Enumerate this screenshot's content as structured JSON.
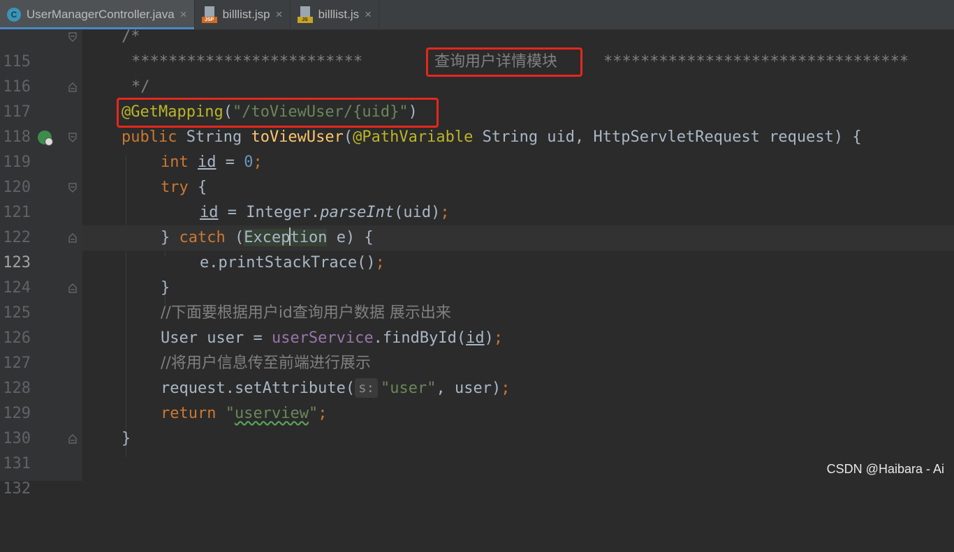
{
  "tabs": [
    {
      "label": "UserManagerController.java",
      "icon": "java-class-icon",
      "active": true
    },
    {
      "label": "billlist.jsp",
      "icon": "jsp-file-icon",
      "active": false
    },
    {
      "label": "billlist.js",
      "icon": "js-file-icon",
      "active": false
    }
  ],
  "tab_close_glyph": "×",
  "file_icon_badges": {
    "jsp": "JSP",
    "js": "JS"
  },
  "class_icon_letter": "C",
  "line_numbers": [
    "115",
    "116",
    "117",
    "118",
    "119",
    "120",
    "121",
    "122",
    "123",
    "124",
    "125",
    "126",
    "127",
    "128",
    "129",
    "130",
    "131",
    "132"
  ],
  "current_line": "123",
  "code": {
    "l115": "/*",
    "l116_stars_left": "*************************",
    "l116_title": "查询用户详情模块",
    "l116_stars_right": "*********************************",
    "l117": "*/",
    "l118_ann": "@GetMapping",
    "l118_open": "(",
    "l118_str": "\"/toViewUser/{uid}\"",
    "l118_close": ")",
    "l119_public": "public",
    "l119_string": " String ",
    "l119_method": "toViewUser",
    "l119_open": "(",
    "l119_ann": "@PathVariable",
    "l119_params": " String uid, HttpServletRequest request) {",
    "l120_int": "int",
    "l120_id": "id",
    "l120_eq": " = ",
    "l120_zero": "0",
    "l120_semi": ";",
    "l121_try": "try",
    "l121_brace": " {",
    "l122_id": "id",
    "l122_rest1": " = Integer.",
    "l122_parse": "parseInt",
    "l122_rest2": "(uid)",
    "l122_semi": ";",
    "l123_brace": "} ",
    "l123_catch": "catch",
    "l123_open": " (",
    "l123_exc_a": "Excep",
    "l123_exc_b": "tion",
    "l123_rest": " e) {",
    "l124_call": "e.printStackTrace()",
    "l124_semi": ";",
    "l125": "}",
    "l126": "//下面要根据用户id查询用户数据 展示出来",
    "l127_a": "User user = ",
    "l127_field": "userService",
    "l127_b": ".findById(",
    "l127_id": "id",
    "l127_c": ")",
    "l127_semi": ";",
    "l128": "//将用户信息传至前端进行展示",
    "l129_a": "request.setAttribute(",
    "l129_hint": "s:",
    "l129_str": "\"user\"",
    "l129_b": ", user)",
    "l129_semi": ";",
    "l130_return": "return",
    "l130_q1": " \"",
    "l130_word": "userview",
    "l130_q2": "\"",
    "l130_semi": ";",
    "l131": "}"
  },
  "watermark": "CSDN @Haibara - Ai",
  "colors": {
    "background": "#2b2b2b",
    "keyword": "#cc7832",
    "string": "#6a8759",
    "annotation": "#bbb529",
    "comment": "#808080",
    "highlight_box": "#e4281c"
  }
}
